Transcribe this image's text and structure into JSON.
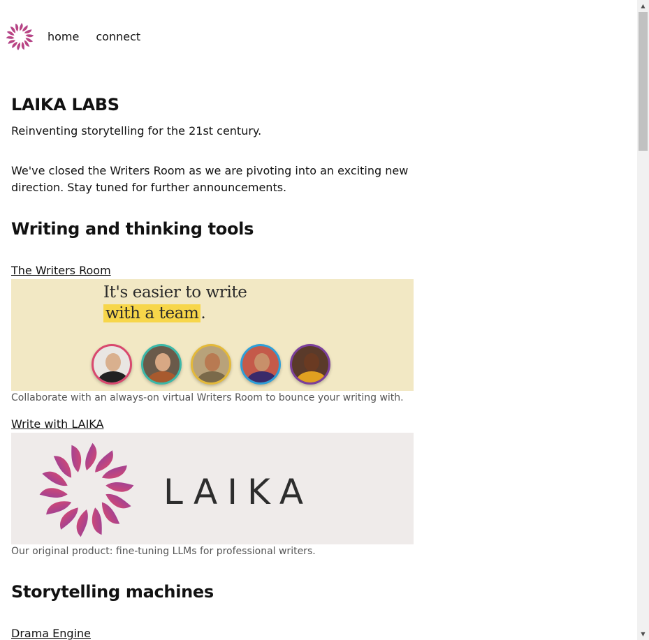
{
  "nav": {
    "logo_icon": "laika-flower-icon",
    "links": [
      "home",
      "connect"
    ]
  },
  "header": {
    "title": "LAIKA LABS",
    "tagline": "Reinventing storytelling for the 21st century."
  },
  "notice": "We've closed the Writers Room as we are pivoting into an exciting new direction. Stay tuned for further announcements.",
  "sections": [
    {
      "heading": "Writing and thinking tools",
      "items": [
        {
          "link": "The Writers Room",
          "banner": {
            "line1": "It's easier to write",
            "line2_highlight": "with a team",
            "line2_end": "."
          },
          "caption": "Collaborate with an always-on virtual Writers Room to bounce your writing with."
        },
        {
          "link": "Write with LAIKA",
          "banner": {
            "wordmark": "LAIKA"
          },
          "caption": "Our original product: fine-tuning LLMs for professional writers."
        }
      ]
    },
    {
      "heading": "Storytelling machines",
      "items": [
        {
          "link": "Drama Engine"
        }
      ]
    }
  ],
  "colors": {
    "writers_room_bg": "#f2e8c4",
    "highlight": "#f7d64a",
    "laika_bg": "#efebea",
    "avatar_rings": [
      "#d9486e",
      "#3bb8a8",
      "#e3b93a",
      "#2e9fd8",
      "#7b3f9c"
    ]
  },
  "scrollbar": {
    "up_icon": "scroll-up-arrow-icon",
    "down_icon": "scroll-down-arrow-icon"
  }
}
